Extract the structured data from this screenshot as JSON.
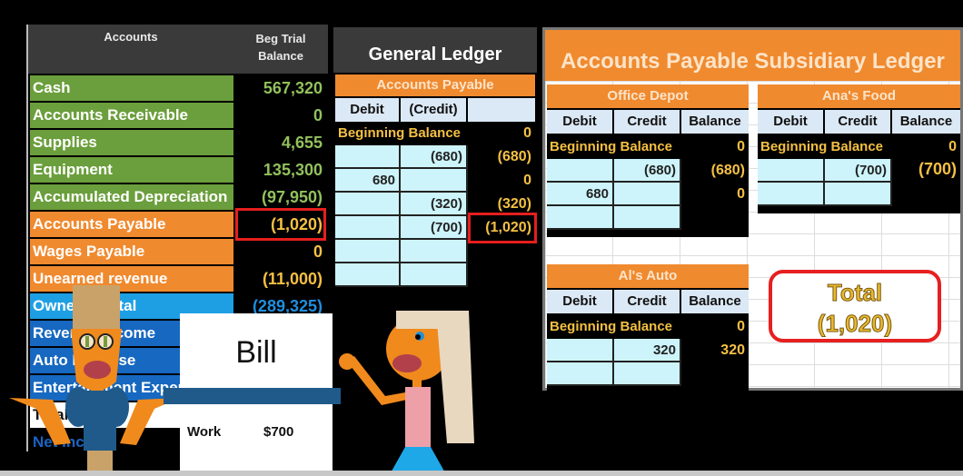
{
  "trial_balance": {
    "header_accounts": "Accounts",
    "header_balance_line1": "Beg Trial",
    "header_balance_line2": "Balance",
    "rows": [
      {
        "name": "Cash",
        "value": "567,320"
      },
      {
        "name": "Accounts Receivable",
        "value": "0"
      },
      {
        "name": "Supplies",
        "value": "4,655"
      },
      {
        "name": "Equipment",
        "value": "135,300"
      },
      {
        "name": "Accumulated Depreciation",
        "value": "(97,950)"
      },
      {
        "name": "Accounts Payable",
        "value": "(1,020)"
      },
      {
        "name": "Wages Payable",
        "value": "0"
      },
      {
        "name": "Unearned revenue",
        "value": "(11,000)"
      },
      {
        "name": "Owner Capital",
        "value": "(289,325)"
      },
      {
        "name": "Revenue Income",
        "value": ""
      },
      {
        "name": "Auto Expense",
        "value": ""
      },
      {
        "name": "Entertainment Expense",
        "value": ""
      },
      {
        "name": "Total",
        "value": ""
      },
      {
        "name": "Net Income",
        "value": ""
      }
    ]
  },
  "general_ledger": {
    "title": "General Ledger",
    "account": "Accounts Payable",
    "col_debit": "Debit",
    "col_credit": "(Credit)",
    "beginning_label": "Beginning Balance",
    "beginning_value": "0",
    "entries": [
      {
        "debit": "",
        "credit": "(680)",
        "balance": "(680)"
      },
      {
        "debit": "680",
        "credit": "",
        "balance": "0"
      },
      {
        "debit": "",
        "credit": "(320)",
        "balance": "(320)"
      },
      {
        "debit": "",
        "credit": "(700)",
        "balance": "(1,020)"
      },
      {
        "debit": "",
        "credit": "",
        "balance": ""
      },
      {
        "debit": "",
        "credit": "",
        "balance": ""
      }
    ]
  },
  "subsidiary": {
    "title": "Accounts Payable Subsidiary Ledger",
    "col_debit": "Debit",
    "col_credit": "Credit",
    "col_balance": "Balance",
    "beginning_label": "Beginning Balance",
    "accounts": [
      {
        "name": "Office Depot",
        "beginning": "0",
        "entries": [
          {
            "debit": "",
            "credit": "(680)",
            "balance": "(680)"
          },
          {
            "debit": "680",
            "credit": "",
            "balance": "0"
          },
          {
            "debit": "",
            "credit": "",
            "balance": ""
          }
        ]
      },
      {
        "name": "Ana's Food",
        "beginning": "0",
        "entries": [
          {
            "debit": "",
            "credit": "(700)",
            "balance": "(700)"
          },
          {
            "debit": "",
            "credit": "",
            "balance": ""
          }
        ]
      },
      {
        "name": "Al's Auto",
        "beginning": "0",
        "entries": [
          {
            "debit": "",
            "credit": "320",
            "balance": "320"
          },
          {
            "debit": "",
            "credit": "",
            "balance": ""
          }
        ]
      }
    ],
    "total_label": "Total",
    "total_value": "(1,020)"
  },
  "bill": {
    "title": "Bill",
    "item": "Work",
    "amount": "$700"
  }
}
